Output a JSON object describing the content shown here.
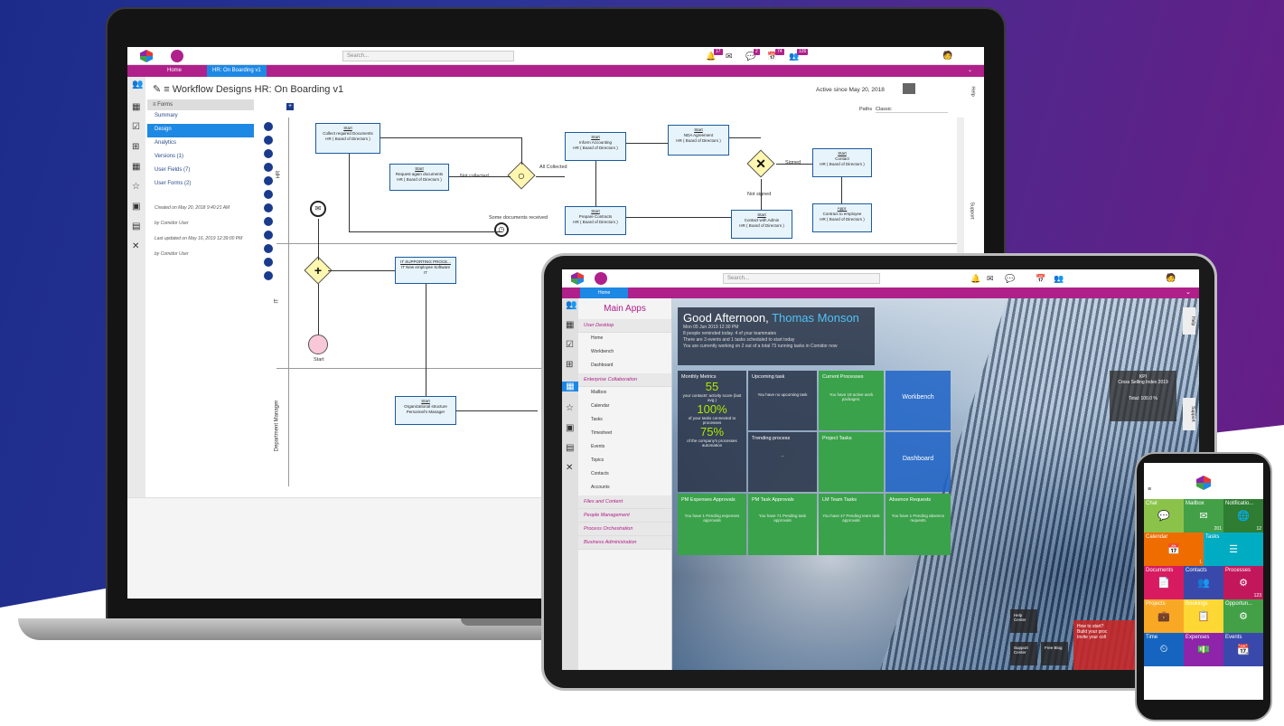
{
  "laptop": {
    "search_placeholder": "Search...",
    "badges": [
      "17",
      "",
      "2",
      "74",
      "126"
    ],
    "nav": [
      "Home",
      "HR: On Boarding v1"
    ],
    "title_prefix": "Workflow Designs",
    "title_name": "HR: On Boarding v1",
    "active_since": "Active since May 20, 2018",
    "paths_label": "Paths",
    "paths_value": "Classic",
    "help": "Help",
    "support": "Support",
    "forms_header": "Forms",
    "forms_items": [
      "Summary",
      "Design",
      "Analytics",
      "Versions (1)",
      "User Fields (7)",
      "User Forms (2)"
    ],
    "meta": [
      "Created on May 20, 2018 9:40:21 AM",
      "by Comidor User",
      "Last updated on May 16, 2019 12:39:00 PM",
      "by Comidor User"
    ],
    "lanes": [
      "HR",
      "IT",
      "Department Manager"
    ],
    "tasks": [
      {
        "t": "Start",
        "d": "Collect required Documents",
        "r": "HR ( Board of Directors )"
      },
      {
        "t": "Start",
        "d": "Request again documents",
        "r": "HR ( Board of Directors )"
      },
      {
        "t": "Start",
        "d": "Inform Accounting",
        "r": "HR ( Board of Directors )"
      },
      {
        "t": "Start",
        "d": "Prepare Contracts",
        "r": "HR ( Board of Directors )"
      },
      {
        "t": "Start",
        "d": "NDA Agreement",
        "r": "HR ( Board of Directors )"
      },
      {
        "t": "Start",
        "d": "Contact with Admin",
        "r": "HR ( Board of Directors )"
      },
      {
        "t": "Start",
        "d": "Contact",
        "r": "HR ( Board of Directors )"
      },
      {
        "t": "Appr.",
        "d": "Contract to employee",
        "r": "HR ( Board of Directors )"
      },
      {
        "t": "IT SUPPORTING PROCE...",
        "d": "IT New employee Software",
        "r": "IT"
      },
      {
        "t": "Start",
        "d": "Organizational structure",
        "r": "Personnel's Manager"
      }
    ],
    "flow_labels": [
      "Not collected",
      "All Collected",
      "Signed",
      "Not signed",
      "Some documents received",
      "Start"
    ]
  },
  "tablet": {
    "search_placeholder": "Search...",
    "nav": [
      "Home"
    ],
    "menu_title": "Main Apps",
    "sections": [
      "User Desktop",
      "Enterprise Collaboration",
      "Files and Content",
      "People Management",
      "Process Orchestration",
      "Business Administration"
    ],
    "desktop_items": [
      "Home",
      "Workbench",
      "Dashboard"
    ],
    "collab_items": [
      "Mailbox",
      "Calendar",
      "Tasks",
      "Timesheet",
      "Events",
      "Topics",
      "Contacts",
      "Accounts"
    ],
    "greeting": "Good Afternoon,",
    "user": "Thomas Monson",
    "date": "Mon 05 Jun 2019 12:30 PM",
    "lines": [
      "8 people reminded today. 4 of your teammates",
      "There are 3 events and 1 tasks scheduled to start today",
      "You are currently working on 2 out of a total 73 running tasks in Comidor now"
    ],
    "tiles": {
      "monthly": "Monthly Metrics",
      "m1": "55",
      "m1s": "your contacts' activity score (last avg.)",
      "m2": "100%",
      "m2s": "of your tasks connected to processes",
      "m3": "75%",
      "m3s": "of the company's processes automation",
      "upcoming": "Upcoming task",
      "upcoming_s": "You have no upcoming task",
      "trending": "Trending process",
      "trending_s": "--",
      "current": "Current Processes",
      "current_s": "You have 19 active work packages.",
      "project": "Project Tasks",
      "workbench": "Workbench",
      "dashboard": "Dashboard",
      "pm": "PM Expenses Approvals",
      "pm_s": "You have 1 Pending expenses approvals",
      "pmtask": "PM Task Approvals",
      "pmtask_s": "You have 71 Pending task approvals",
      "lm": "LM Team Tasks",
      "lm_s": "You have 47 Pending team task approvals",
      "absence": "Absence Requests",
      "absence_s": "You have 1 Pending absence requests"
    },
    "kpi": {
      "title": "KPI",
      "sub": "Cross Selling Index 2019",
      "total": "Total: 100.0 %"
    },
    "how": "How to start?",
    "build": "Build your proc",
    "invite": "Invite your coll",
    "buttons": [
      "Help Center",
      "Support Center",
      "Free Blog"
    ]
  },
  "phone": {
    "tiles": [
      {
        "l": "Chat",
        "i": "💬",
        "n": "",
        "c": "#8bc34a"
      },
      {
        "l": "Mailbox",
        "i": "✉",
        "n": "201",
        "c": "#43a047"
      },
      {
        "l": "Notificatio...",
        "i": "🌐",
        "n": "12",
        "c": "#2e7d32"
      },
      {
        "l": "Calendar",
        "i": "📅",
        "n": "1",
        "c": "#ef6c00"
      },
      {
        "l": "Tasks",
        "i": "☰",
        "n": "",
        "c": "#00acc1"
      },
      {
        "l": "Documents",
        "i": "📄",
        "n": "",
        "c": "#d81b60"
      },
      {
        "l": "Contacts",
        "i": "👥",
        "n": "",
        "c": "#3949ab"
      },
      {
        "l": "Processes",
        "i": "⚙",
        "n": "123",
        "c": "#c2185b"
      },
      {
        "l": "Projects",
        "i": "💼",
        "n": "",
        "c": "#f9a825"
      },
      {
        "l": "Bookings",
        "i": "📋",
        "n": "",
        "c": "#fdd835"
      },
      {
        "l": "Opportun...",
        "i": "⚙",
        "n": "",
        "c": "#43a047"
      },
      {
        "l": "Time",
        "i": "⏲",
        "n": "",
        "c": "#1565c0"
      },
      {
        "l": "Expenses",
        "i": "💵",
        "n": "",
        "c": "#8e24aa"
      },
      {
        "l": "Events",
        "i": "📆",
        "n": "",
        "c": "#3949ab"
      }
    ]
  }
}
